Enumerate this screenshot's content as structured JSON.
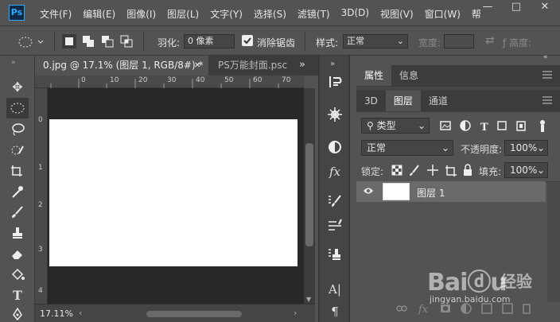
{
  "app": {
    "logo": "Ps"
  },
  "menu": [
    "文件(F)",
    "编辑(E)",
    "图像(I)",
    "图层(L)",
    "文字(Y)",
    "选择(S)",
    "滤镜(T)",
    "3D(D)",
    "视图(V)",
    "窗口(W)",
    "帮"
  ],
  "window_controls": {
    "minimize": "—",
    "maximize": "□",
    "close": "✕"
  },
  "options": {
    "feather_label": "羽化:",
    "feather_value": "0 像素",
    "antialias_label": "消除锯齿",
    "style_label": "样式:",
    "style_value": "正常",
    "width_label": "宽度:",
    "height_label": "高度:"
  },
  "document": {
    "tabs": [
      {
        "label": "0.jpg @ 17.1% (图层 1, RGB/8#) *",
        "close": "✕"
      },
      {
        "label": "PS万能封面.psc"
      }
    ],
    "overflow": "»",
    "ruler_top": [
      "0",
      "10",
      "20",
      "30",
      "40",
      "50",
      "60",
      "70",
      "80"
    ],
    "ruler_left": [
      "0",
      "1",
      "2",
      "3",
      "4"
    ],
    "zoom": "17.11%"
  },
  "panel": {
    "top_tabs": [
      "属性",
      "信息"
    ],
    "layer_tabs": [
      "3D",
      "图层",
      "通道"
    ],
    "filter_label": "类型",
    "blend_mode": "正常",
    "opacity_label": "不透明度:",
    "opacity_value": "100%",
    "lock_label": "锁定:",
    "fill_label": "填充:",
    "fill_value": "100%",
    "layers": [
      {
        "name": "图层 1",
        "visible": true
      }
    ]
  },
  "watermark": {
    "logo": "Baiⓓu",
    "name": "经验",
    "url": "jingyan.baidu.com"
  },
  "colors": {
    "accent": "#31a8ff",
    "panel_bg": "#535353",
    "canvas_bg": "#282828"
  }
}
